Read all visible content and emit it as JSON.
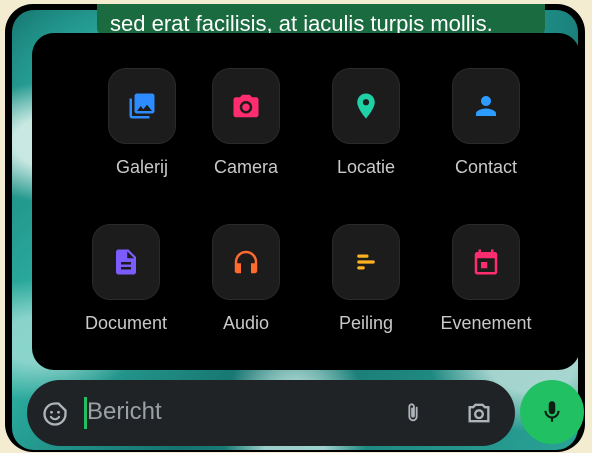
{
  "chat": {
    "message_fragment": "sed erat facilisis, at iaculis turpis mollis."
  },
  "attach_menu": {
    "items": [
      {
        "label": "Galerij",
        "icon": "gallery-icon",
        "color": "#2d8cff"
      },
      {
        "label": "Camera",
        "icon": "camera-icon",
        "color": "#ff2d6f"
      },
      {
        "label": "Locatie",
        "icon": "location-pin-icon",
        "color": "#1fd1a5"
      },
      {
        "label": "Contact",
        "icon": "contact-person-icon",
        "color": "#2d9cff"
      },
      {
        "label": "Document",
        "icon": "document-icon",
        "color": "#7c5cff"
      },
      {
        "label": "Audio",
        "icon": "headphones-icon",
        "color": "#ff6a2d"
      },
      {
        "label": "Peiling",
        "icon": "poll-icon",
        "color": "#ffb21f"
      },
      {
        "label": "Evenement",
        "icon": "calendar-event-icon",
        "color": "#ff2d6f"
      }
    ]
  },
  "composer": {
    "placeholder": "Bericht",
    "accent": "#21c063"
  }
}
